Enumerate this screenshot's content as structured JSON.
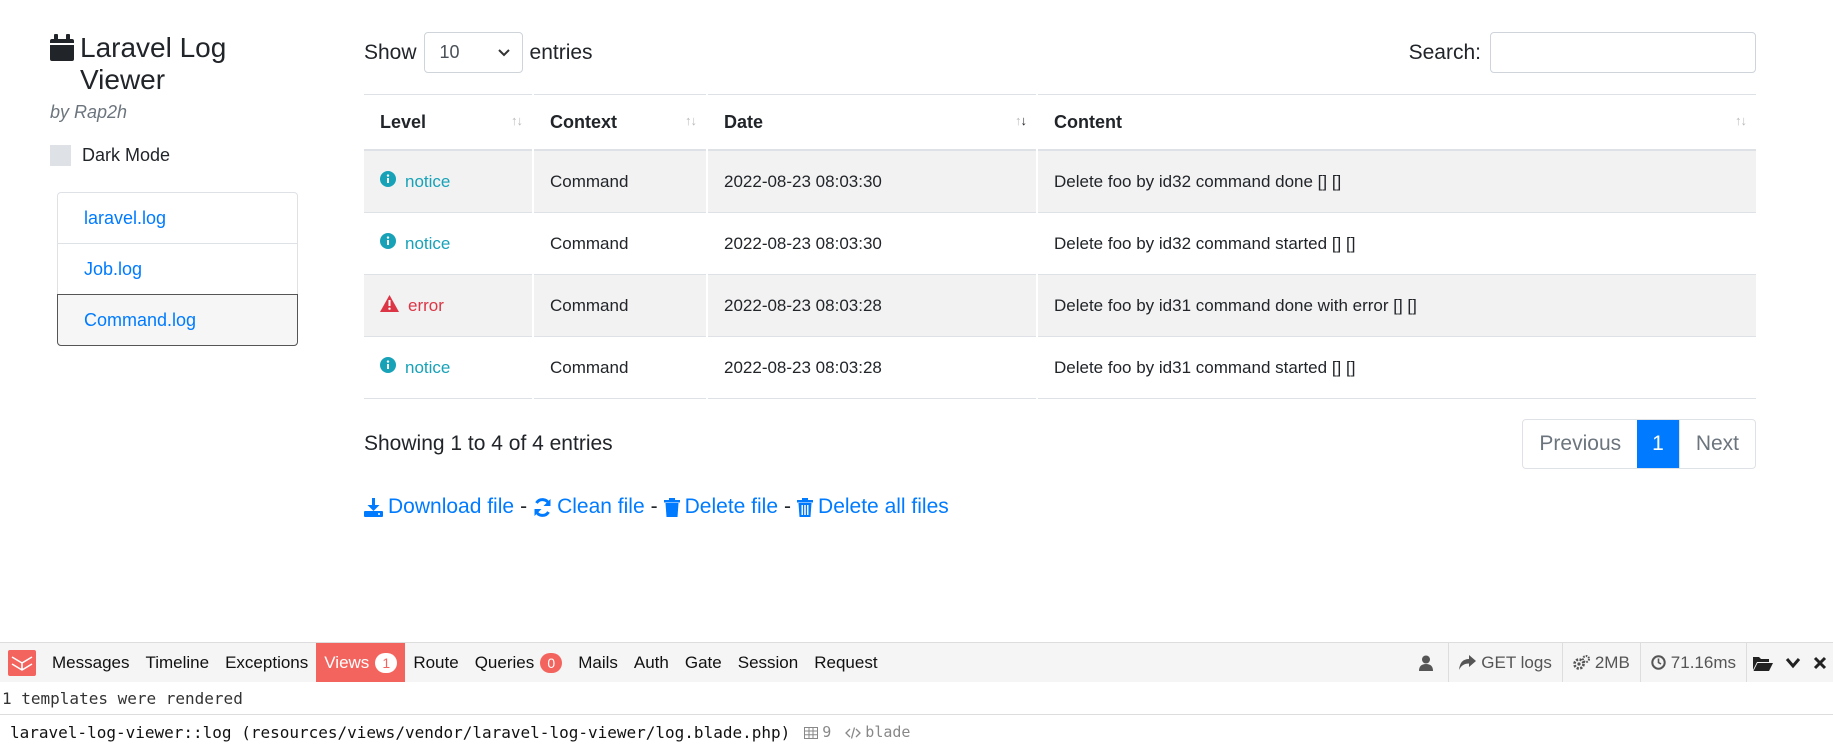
{
  "app": {
    "title": "Laravel Log Viewer",
    "by": "by Rap2h",
    "dark_mode_label": "Dark Mode"
  },
  "files": [
    {
      "name": "laravel.log",
      "active": false
    },
    {
      "name": "Job.log",
      "active": false
    },
    {
      "name": "Command.log",
      "active": true
    }
  ],
  "controls": {
    "show_label": "Show",
    "entries_label": "entries",
    "page_size": "10",
    "search_label": "Search:",
    "search_value": ""
  },
  "table": {
    "columns": [
      "Level",
      "Context",
      "Date",
      "Content"
    ],
    "rows": [
      {
        "level": "notice",
        "context": "Command",
        "date": "2022-08-23 08:03:30",
        "content": "Delete foo by id32 command done [] []"
      },
      {
        "level": "notice",
        "context": "Command",
        "date": "2022-08-23 08:03:30",
        "content": "Delete foo by id32 command started [] []"
      },
      {
        "level": "error",
        "context": "Command",
        "date": "2022-08-23 08:03:28",
        "content": "Delete foo by id31 command done with error [] []"
      },
      {
        "level": "notice",
        "context": "Command",
        "date": "2022-08-23 08:03:28",
        "content": "Delete foo by id31 command started [] []"
      }
    ]
  },
  "footer": {
    "showing": "Showing 1 to 4 of 4 entries",
    "prev": "Previous",
    "page": "1",
    "next": "Next"
  },
  "actions": {
    "download": "Download file",
    "clean": "Clean file",
    "delete": "Delete file",
    "delete_all": "Delete all files",
    "separator": "-"
  },
  "debugbar": {
    "tabs": {
      "messages": "Messages",
      "timeline": "Timeline",
      "exceptions": "Exceptions",
      "views": "Views",
      "views_count": "1",
      "route": "Route",
      "queries": "Queries",
      "queries_count": "0",
      "mails": "Mails",
      "auth": "Auth",
      "gate": "Gate",
      "session": "Session",
      "request": "Request"
    },
    "right": {
      "method_route": "GET logs",
      "memory": "2MB",
      "time": "71.16ms"
    },
    "panel": {
      "summary": "1 templates were rendered",
      "template": "laravel-log-viewer::log (resources/views/vendor/laravel-log-viewer/log.blade.php)",
      "params": "9",
      "type": "blade"
    }
  },
  "colors": {
    "link": "#007bff",
    "notice": "#17a2b8",
    "error": "#dc3545",
    "debugbar_accent": "#f4645f"
  }
}
